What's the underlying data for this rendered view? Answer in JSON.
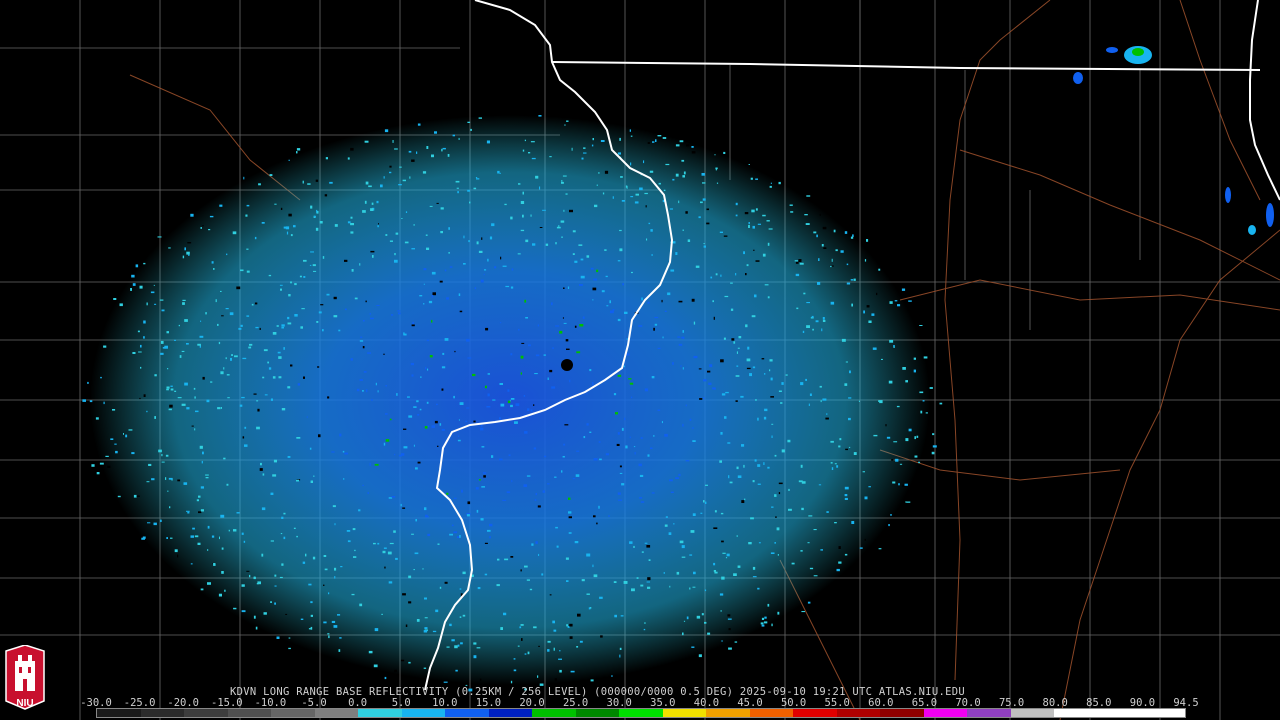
{
  "caption": "KDVN LONG RANGE BASE REFLECTIVITY (0.25KM / 256 LEVEL) (000000/0000 0.5 DEG) 2025-09-10 19:21 UTC  ATLAS.NIU.EDU",
  "logo_text": "NIU",
  "scale": {
    "labels": [
      "-30.0",
      "-25.0",
      "-20.0",
      "-15.0",
      "-10.0",
      "-5.0",
      "0.0",
      "5.0",
      "10.0",
      "15.0",
      "20.0",
      "25.0",
      "30.0",
      "35.0",
      "40.0",
      "45.0",
      "50.0",
      "55.0",
      "60.0",
      "65.0",
      "70.0",
      "75.0",
      "80.0",
      "85.0",
      "90.0",
      "94.5"
    ],
    "colors": [
      "#1a1a1a",
      "#2b2b2b",
      "#3d3d3d",
      "#505050",
      "#666666",
      "#7f7f7f",
      "#30d0e0",
      "#18b4f0",
      "#1060f0",
      "#0020c0",
      "#00c000",
      "#008800",
      "#00e000",
      "#f0e000",
      "#f0a000",
      "#f06000",
      "#e00000",
      "#b00000",
      "#900000",
      "#f000f0",
      "#9040c0",
      "#c0c0c0",
      "#ffffff",
      "#ffffff",
      "#ffffff"
    ]
  },
  "map": {
    "radar_site": "KDVN",
    "state_border_color": "#ffffff",
    "county_line_color": "#8c8c8c",
    "road_color": "#a0522d",
    "echo_colors": [
      "#30d0e0",
      "#18b4f0",
      "#1060f0",
      "#0020c0",
      "#00c000"
    ]
  }
}
